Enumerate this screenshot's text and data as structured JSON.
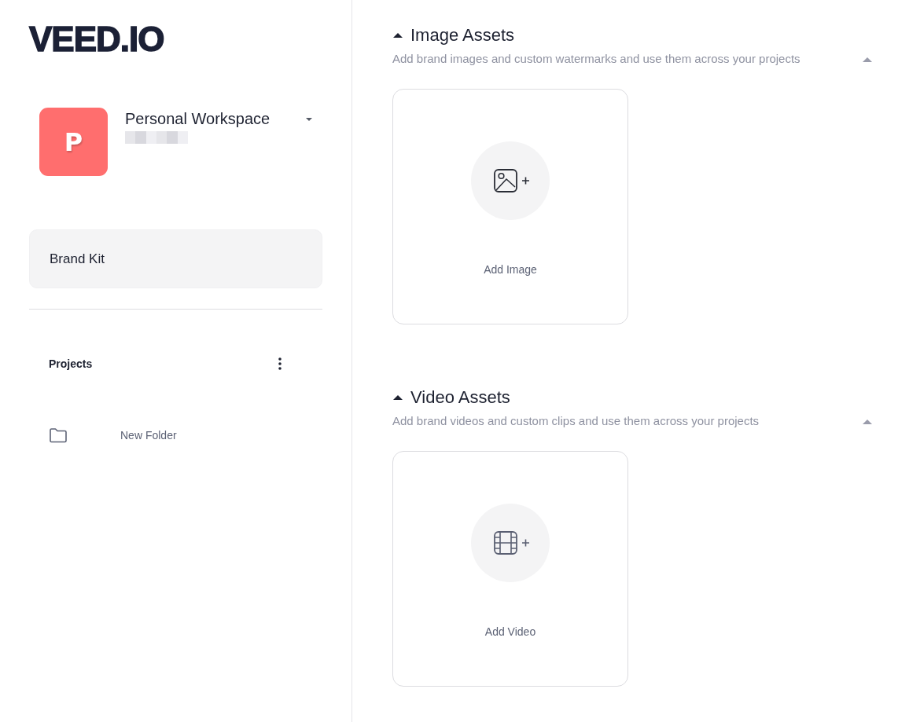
{
  "sidebar": {
    "logo": "VEED.IO",
    "workspace": {
      "initial": "P",
      "name": "Personal Workspace"
    },
    "items": [
      {
        "label": "Brand Kit",
        "selected": true
      }
    ],
    "projects": {
      "title": "Projects",
      "folders": [
        {
          "name": "New Folder"
        }
      ]
    }
  },
  "sections": [
    {
      "kind": "image",
      "title": "Image Assets",
      "expanded": true,
      "description": "Add brand images and custom watermarks and use them across your projects",
      "card_label": "Add Image"
    },
    {
      "kind": "video",
      "title": "Video Assets",
      "expanded": true,
      "description": "Add brand videos and custom clips and use them across your projects",
      "card_label": "Add Video"
    }
  ]
}
